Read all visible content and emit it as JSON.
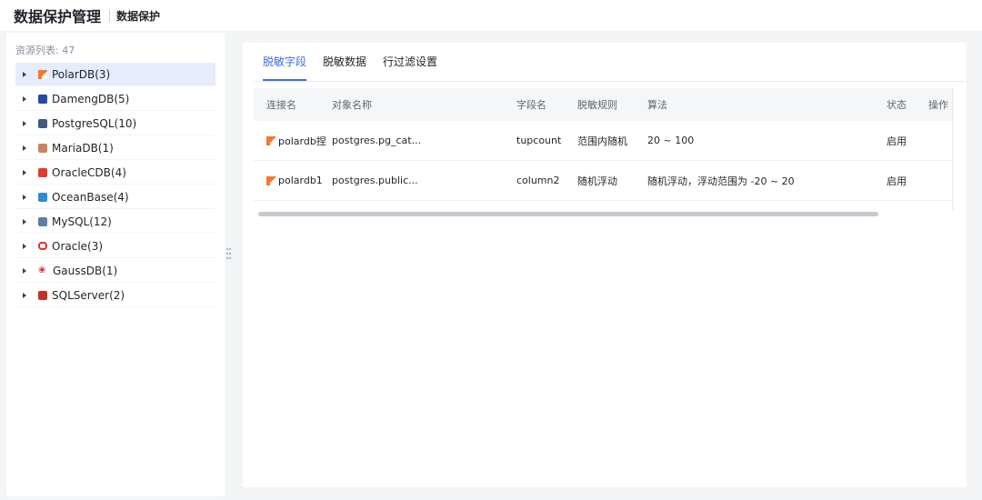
{
  "header": {
    "title": "数据保护管理",
    "subtitle": "数据保护"
  },
  "sidebar": {
    "count_label": "资源列表: 47",
    "items": [
      {
        "label": "PolarDB(3)",
        "icon": "polardb-icon",
        "active": true
      },
      {
        "label": "DamengDB(5)",
        "icon": "damengdb-icon"
      },
      {
        "label": "PostgreSQL(10)",
        "icon": "postgresql-icon"
      },
      {
        "label": "MariaDB(1)",
        "icon": "mariadb-icon"
      },
      {
        "label": "OracleCDB(4)",
        "icon": "oraclecdb-icon"
      },
      {
        "label": "OceanBase(4)",
        "icon": "oceanbase-icon"
      },
      {
        "label": "MySQL(12)",
        "icon": "mysql-icon"
      },
      {
        "label": "Oracle(3)",
        "icon": "oracle-icon"
      },
      {
        "label": "GaussDB(1)",
        "icon": "gaussdb-icon"
      },
      {
        "label": "SQLServer(2)",
        "icon": "sqlserver-icon"
      }
    ]
  },
  "tabs": [
    {
      "label": "脱敏字段",
      "active": true
    },
    {
      "label": "脱敏数据"
    },
    {
      "label": "行过滤设置"
    }
  ],
  "table": {
    "columns": [
      "连接名",
      "对象名称",
      "字段名",
      "脱敏规则",
      "算法",
      "状态",
      "操作"
    ],
    "rows": [
      {
        "conn": "polardb捏",
        "object": "postgres.pg_cat...",
        "field": "tupcount",
        "rule": "范围内随机",
        "algo": "20 ~ 100",
        "status": "启用"
      },
      {
        "conn": "polardb1",
        "object": "postgres.public...",
        "field": "column2",
        "rule": "随机浮动",
        "algo": "随机浮动，浮动范围为 -20 ~ 20",
        "status": "启用"
      }
    ]
  },
  "colors": {
    "accent": "#3a6ee8",
    "active_bg": "#e6ecfb",
    "polar_orange": "#f5782c"
  }
}
